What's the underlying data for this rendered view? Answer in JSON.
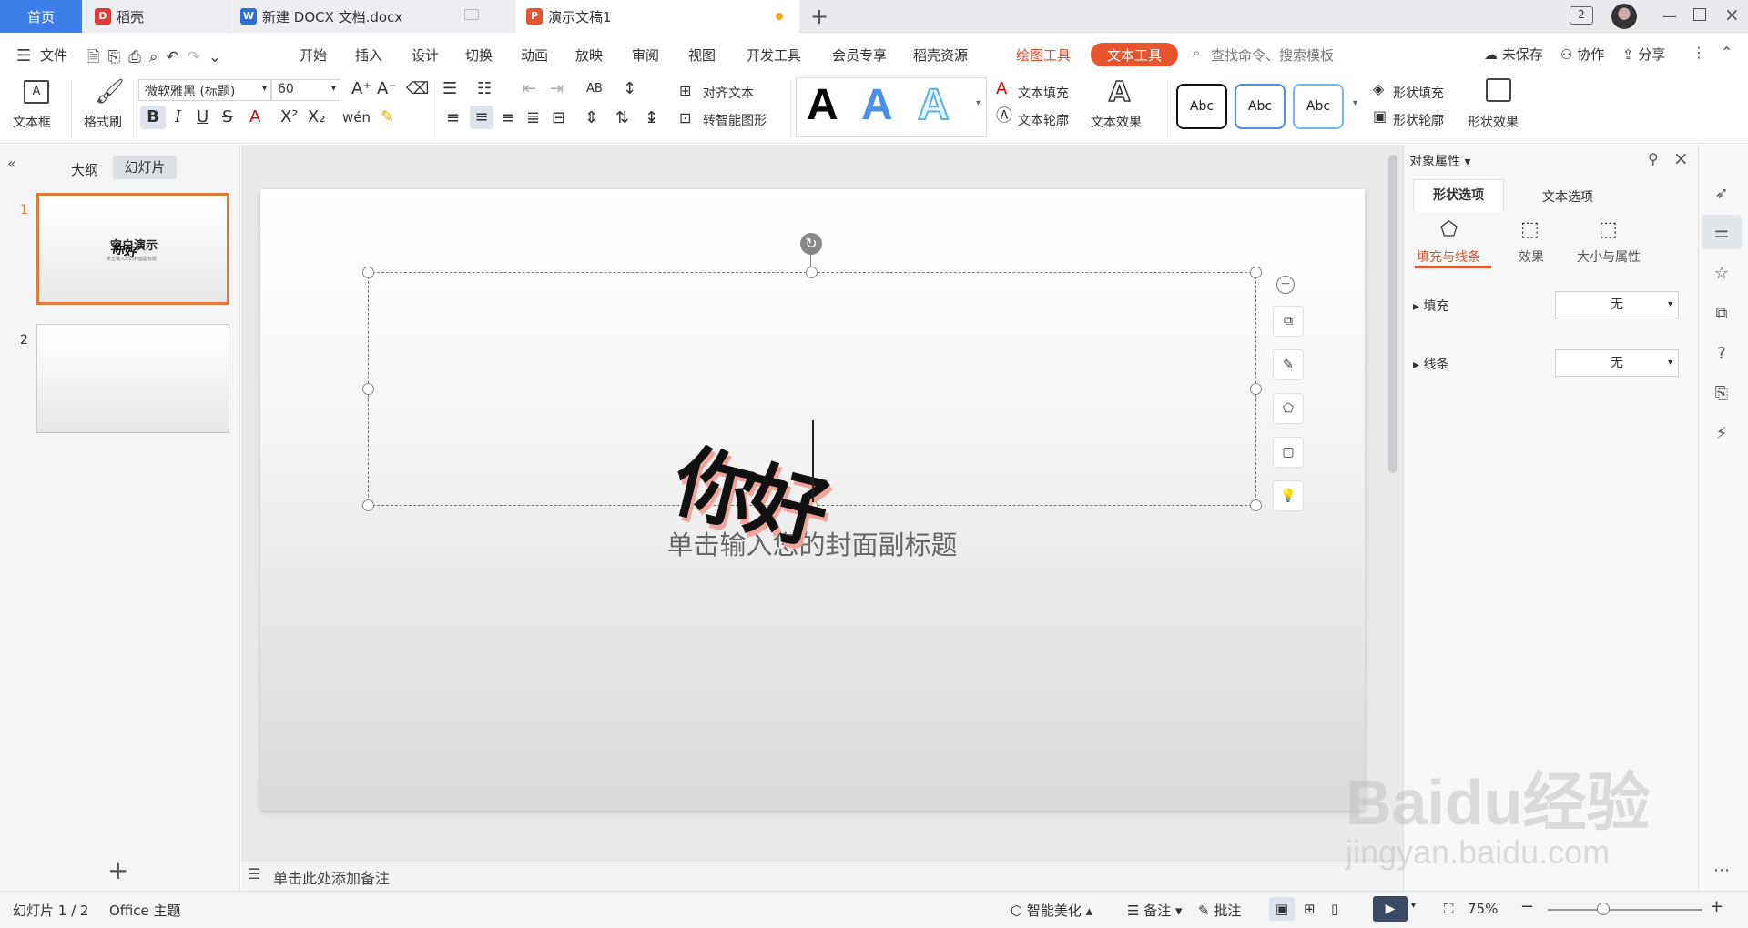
{
  "tabs": {
    "home": "首页",
    "daoke": "稻壳",
    "docx": "新建 DOCX 文档.docx",
    "ppt": "演示文稿1",
    "window_badge": "2"
  },
  "menu": {
    "file": "文件",
    "items": [
      "开始",
      "插入",
      "设计",
      "切换",
      "动画",
      "放映",
      "审阅",
      "视图",
      "开发工具",
      "会员专享",
      "稻壳资源"
    ],
    "drawing_tools": "绘图工具",
    "text_tools": "文本工具",
    "search_placeholder": "查找命令、搜索模板",
    "unsaved": "未保存",
    "collab": "协作",
    "share": "分享"
  },
  "ribbon": {
    "textbox": "文本框",
    "format_painter": "格式刷",
    "font_name": "微软雅黑 (标题)",
    "font_size": "60",
    "align_text": "对齐文本",
    "smart_shape": "转智能图形",
    "text_fill": "文本填充",
    "text_outline": "文本轮廓",
    "text_effect": "文本效果",
    "shape_style_label": "Abc",
    "shape_fill": "形状填充",
    "shape_outline": "形状轮廓",
    "shape_effect": "形状效果",
    "art_letter": "A"
  },
  "left_panel": {
    "outline_tab": "大纲",
    "slides_tab": "幻灯片",
    "slide_numbers": [
      "1",
      "2"
    ],
    "thumb1_title": "空白演示",
    "thumb1_art": "你好",
    "thumb1_sub": "单击输入您的封面副标题",
    "add_slide": "+"
  },
  "slide": {
    "art_text": "你好",
    "subtitle": "单击输入您的封面副标题"
  },
  "notes": {
    "placeholder": "单击此处添加备注"
  },
  "right_panel": {
    "title": "对象属性",
    "tab_shape": "形状选项",
    "tab_text": "文本选项",
    "sub_fill_line": "填充与线条",
    "sub_effect": "效果",
    "sub_size": "大小与属性",
    "fill_label": "填充",
    "fill_value": "无",
    "line_label": "线条",
    "line_value": "无"
  },
  "status": {
    "slide_info": "幻灯片 1 / 2",
    "theme": "Office 主题",
    "beautify": "智能美化",
    "notes": "备注",
    "comments": "批注",
    "zoom": "75%"
  },
  "watermark": {
    "brand": "Baidu经验",
    "url": "jingyan.baidu.com"
  },
  "colors": {
    "accent": "#3b7de9",
    "text_tool": "#e8542e",
    "selected_thumb": "#e07a3b"
  }
}
